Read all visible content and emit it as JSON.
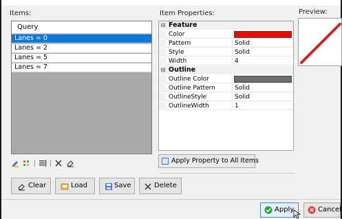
{
  "items_label": "Items:",
  "properties_label": "Item Properties:",
  "preview_label": "Preview:",
  "items": {
    "header": "Query",
    "rows": [
      "Lanes = 0",
      "Lanes = 2",
      "Lanes = 5",
      "Lanes = 7"
    ],
    "selected_index": 0
  },
  "properties": {
    "feature_category": "Feature",
    "feature_rows": [
      {
        "name": "Color",
        "value": "",
        "swatch": "#ff0000"
      },
      {
        "name": "Pattern",
        "value": "Solid"
      },
      {
        "name": "Style",
        "value": "Solid"
      },
      {
        "name": "Width",
        "value": "4"
      }
    ],
    "outline_category": "Outline",
    "outline_rows": [
      {
        "name": "Outline Color",
        "value": "",
        "swatch": "#6e6e6e"
      },
      {
        "name": "Outline Pattern",
        "value": "Solid"
      },
      {
        "name": "OutlineStyle",
        "value": "Solid"
      },
      {
        "name": "OutlineWidth",
        "value": "1"
      }
    ]
  },
  "apply_all_label": "Apply Property to All Items",
  "buttons": {
    "clear": "Clear",
    "load": "Load",
    "save": "Save",
    "delete": "Delete",
    "apply": "Apply",
    "cancel": "Cancel"
  },
  "colors": {
    "selection": "#0a78d7",
    "preview_line": "#d42020",
    "apply_icon": "#2aa52a",
    "cancel_icon": "#e04040"
  },
  "icons": [
    "edit-style-icon",
    "grid-icon",
    "list-icon",
    "delete-x-icon",
    "eraser-icon",
    "apply-check-icon",
    "cancel-icon",
    "load-icon",
    "save-icon",
    "cursor-icon"
  ]
}
